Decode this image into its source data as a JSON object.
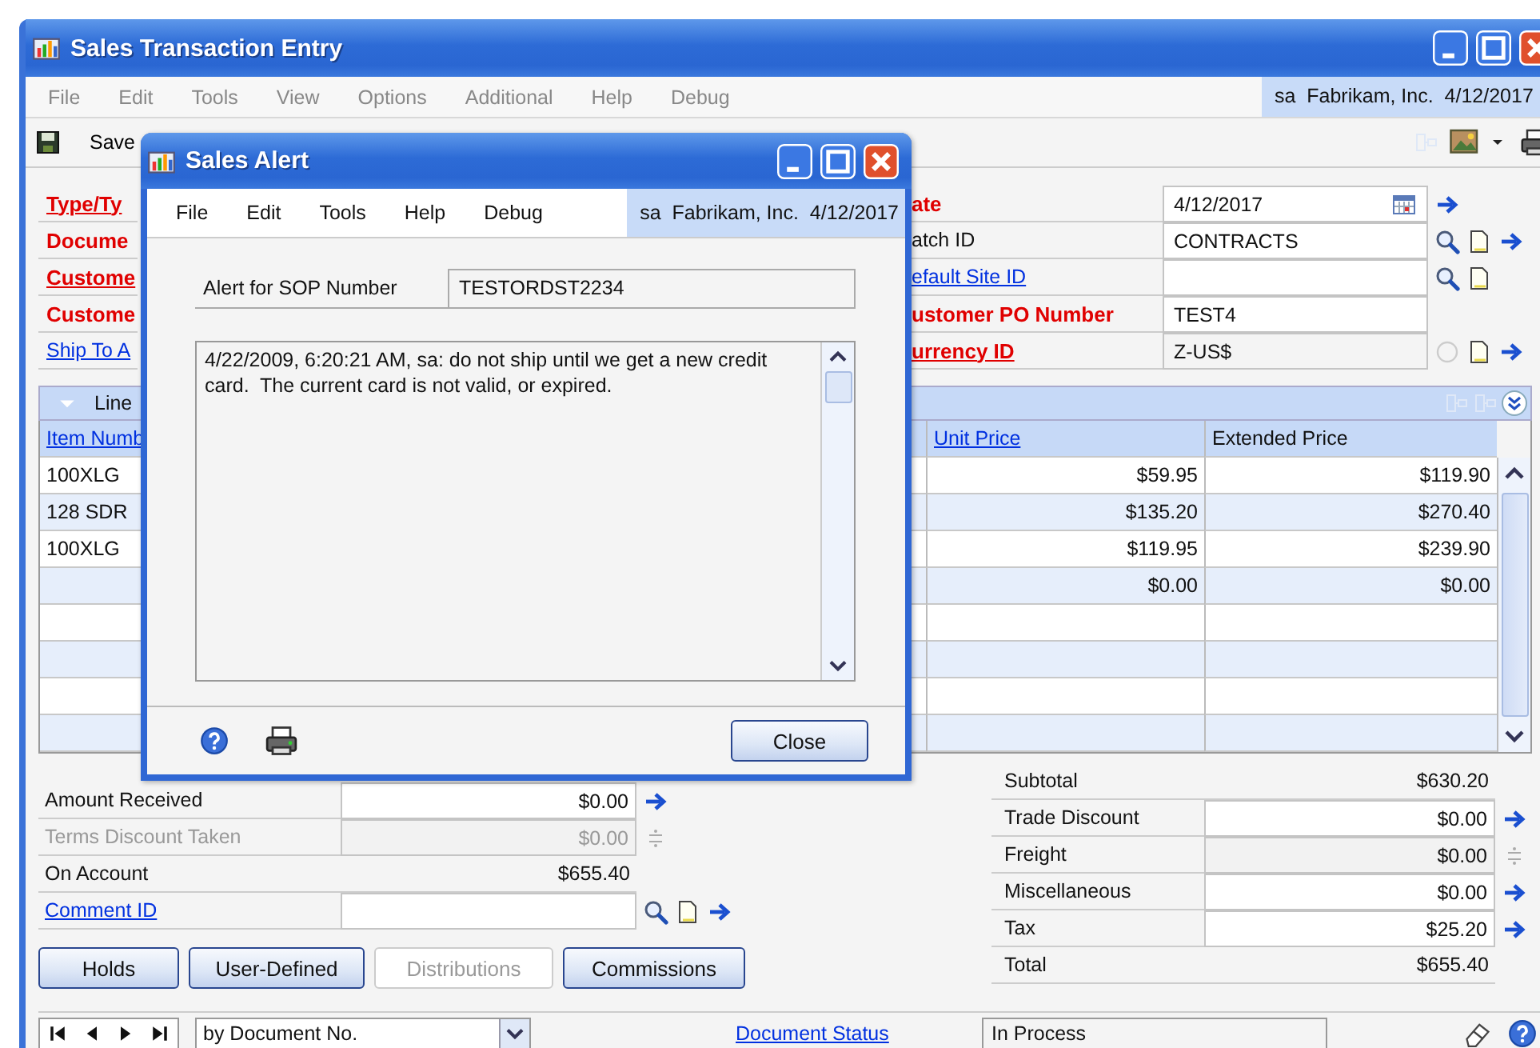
{
  "window": {
    "title": "Sales Transaction Entry"
  },
  "menu": [
    {
      "label": "File",
      "disabled": true
    },
    {
      "label": "Edit",
      "disabled": true
    },
    {
      "label": "Tools",
      "disabled": true
    },
    {
      "label": "View",
      "disabled": true
    },
    {
      "label": "Options",
      "disabled": true
    },
    {
      "label": "Additional",
      "disabled": true
    },
    {
      "label": "Help",
      "disabled": true
    },
    {
      "label": "Debug",
      "disabled": true
    }
  ],
  "user_info": "sa  Fabrikam, Inc.  4/12/2017",
  "toolbar": {
    "save_label": "Save"
  },
  "header": {
    "left_labels": [
      {
        "label": "Type/Ty",
        "kind": "required-link"
      },
      {
        "label": "Docume",
        "kind": "required"
      },
      {
        "label": "Custome",
        "kind": "required-link"
      },
      {
        "label": "Custome",
        "kind": "required"
      },
      {
        "label": "Ship To A",
        "kind": "link"
      }
    ],
    "right_fields": [
      {
        "label": {
          "text": "ate",
          "kind": "required"
        },
        "field": {
          "value": "4/12/2017",
          "kind": "date"
        }
      },
      {
        "label": {
          "text": "atch ID",
          "kind": "plain"
        },
        "field": {
          "value": "CONTRACTS",
          "kind": "lookup"
        }
      },
      {
        "label": {
          "text": "efault Site ID",
          "kind": "link"
        },
        "field": {
          "kind": "lookup-note"
        }
      },
      {
        "label": {
          "text": "ustomer PO Number",
          "kind": "required"
        },
        "field": {
          "value": "TEST4",
          "kind": "plain"
        }
      },
      {
        "label": {
          "text": "urrency ID",
          "kind": "required-link"
        },
        "field": {
          "value": "Z-US$",
          "kind": "currency"
        }
      }
    ]
  },
  "grid": {
    "title": "Line",
    "columns": [
      {
        "label": "Item Numb",
        "link": true
      },
      {
        "label": "Unit Price",
        "link": true
      },
      {
        "label": "Extended Price",
        "link": false
      }
    ],
    "rows": [
      {
        "item": "100XLG",
        "unit_price": "$59.95",
        "extended_price": "$119.90"
      },
      {
        "item": "128 SDR",
        "unit_price": "$135.20",
        "extended_price": "$270.40"
      },
      {
        "item": "100XLG",
        "unit_price": "$119.95",
        "extended_price": "$239.90"
      },
      {
        "unit_price": "$0.00",
        "extended_price": "$0.00"
      }
    ]
  },
  "payment_rows": [
    {
      "label": {
        "text": "Amount Received",
        "kind": "plain"
      },
      "field": {
        "value": "$0.00",
        "kind": "arrow"
      },
      "disabled": false
    },
    {
      "label": {
        "text": "Terms Discount Taken",
        "kind": "plain"
      },
      "field": {
        "value": "$0.00",
        "kind": "spin"
      },
      "disabled": true
    },
    {
      "label": {
        "text": "On Account",
        "kind": "plain"
      },
      "field": {
        "value": "$655.40",
        "kind": "readonly"
      },
      "disabled": false
    },
    {
      "label": {
        "text": "Comment ID",
        "kind": "link"
      },
      "field": {
        "kind": "lookup"
      },
      "disabled": false
    }
  ],
  "buttons": [
    {
      "label": "Holds",
      "disabled": false
    },
    {
      "label": "User-Defined",
      "disabled": false
    },
    {
      "label": "Distributions",
      "disabled": true
    },
    {
      "label": "Commissions",
      "disabled": false
    }
  ],
  "totals": [
    {
      "label": "Subtotal",
      "value": "$630.20",
      "kind": "readonly"
    },
    {
      "label": "Trade Discount",
      "value": "$0.00",
      "kind": "arrow"
    },
    {
      "label": "Freight",
      "value": "$0.00",
      "kind": "spin"
    },
    {
      "label": "Miscellaneous",
      "value": "$0.00",
      "kind": "arrow"
    },
    {
      "label": "Tax",
      "value": "$25.20",
      "kind": "arrow"
    },
    {
      "label": "Total",
      "value": "$655.40",
      "kind": "readonly"
    }
  ],
  "status_bar": {
    "sort": "by Document No.",
    "link": "Document Status",
    "status": "In Process"
  },
  "dialog": {
    "title": "Sales Alert",
    "menu": [
      {
        "label": "File",
        "disabled": false
      },
      {
        "label": "Edit",
        "disabled": false
      },
      {
        "label": "Tools",
        "disabled": false
      },
      {
        "label": "Help",
        "disabled": false
      },
      {
        "label": "Debug",
        "disabled": false
      }
    ],
    "user_info": "sa  Fabrikam, Inc.  4/12/2017",
    "field_label": "Alert for SOP Number",
    "field_value": "TESTORDST2234",
    "message": "4/22/2009, 6:20:21 AM, sa: do not ship until we get a new credit card.  The current card is not valid, or expired.",
    "close_label": "Close"
  }
}
